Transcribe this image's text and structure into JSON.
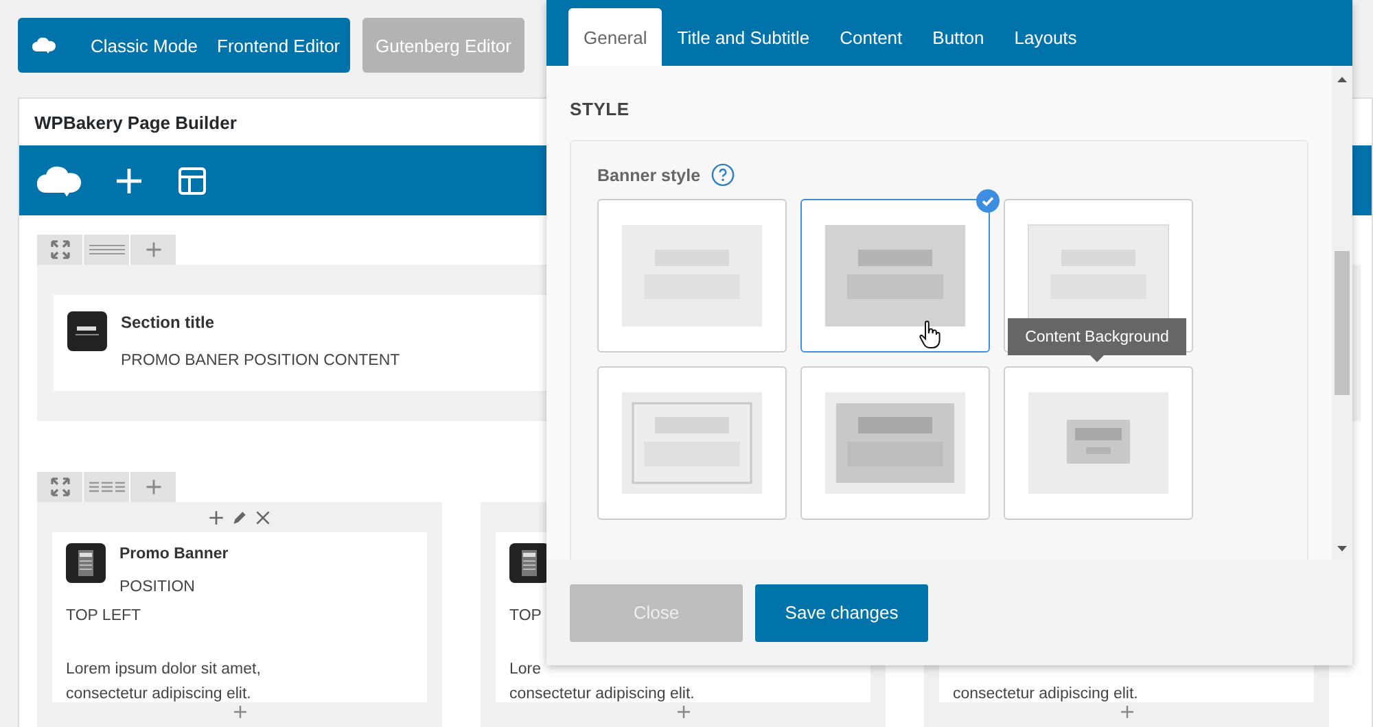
{
  "editor_modes": {
    "buttons": [
      {
        "label": "Classic Mode"
      },
      {
        "label": "Frontend Editor"
      }
    ],
    "gutenberg": {
      "label": "Gutenberg Editor",
      "disabled": true
    }
  },
  "builder": {
    "title": "WPBakery Page Builder",
    "section_row": {
      "title": "Section title",
      "text": "PROMO BANER POSITION CONTENT"
    },
    "columns": [
      {
        "show_controls": true,
        "title": "Promo Banner",
        "position_label": "POSITION",
        "position_value": "TOP LEFT",
        "text_lines": [
          "Lorem ipsum dolor sit amet,",
          "consectetur adipiscing elit."
        ]
      },
      {
        "position_value": "TOP",
        "text_lines": [
          "Lore",
          "consectetur adipiscing elit."
        ]
      },
      {
        "text_lines": [
          "consectetur adipiscing elit."
        ]
      }
    ]
  },
  "modal": {
    "tabs": [
      {
        "label": "General",
        "selected": true
      },
      {
        "label": "Title and Subtitle",
        "selected": false
      },
      {
        "label": "Content",
        "selected": false
      },
      {
        "label": "Button",
        "selected": false
      },
      {
        "label": "Layouts",
        "selected": false
      }
    ],
    "section_title": "STYLE",
    "field_label": "Banner style",
    "options": [
      {
        "kind": "flat",
        "selected": false
      },
      {
        "kind": "filled",
        "selected": true
      },
      {
        "kind": "shadow",
        "selected": false
      },
      {
        "kind": "framed",
        "selected": false
      },
      {
        "kind": "boxed",
        "selected": false
      },
      {
        "kind": "centered",
        "selected": false,
        "tooltip": "Content Background"
      }
    ],
    "buttons": [
      {
        "label": "Close",
        "kind": "secondary"
      },
      {
        "label": "Save changes",
        "kind": "primary"
      }
    ]
  }
}
